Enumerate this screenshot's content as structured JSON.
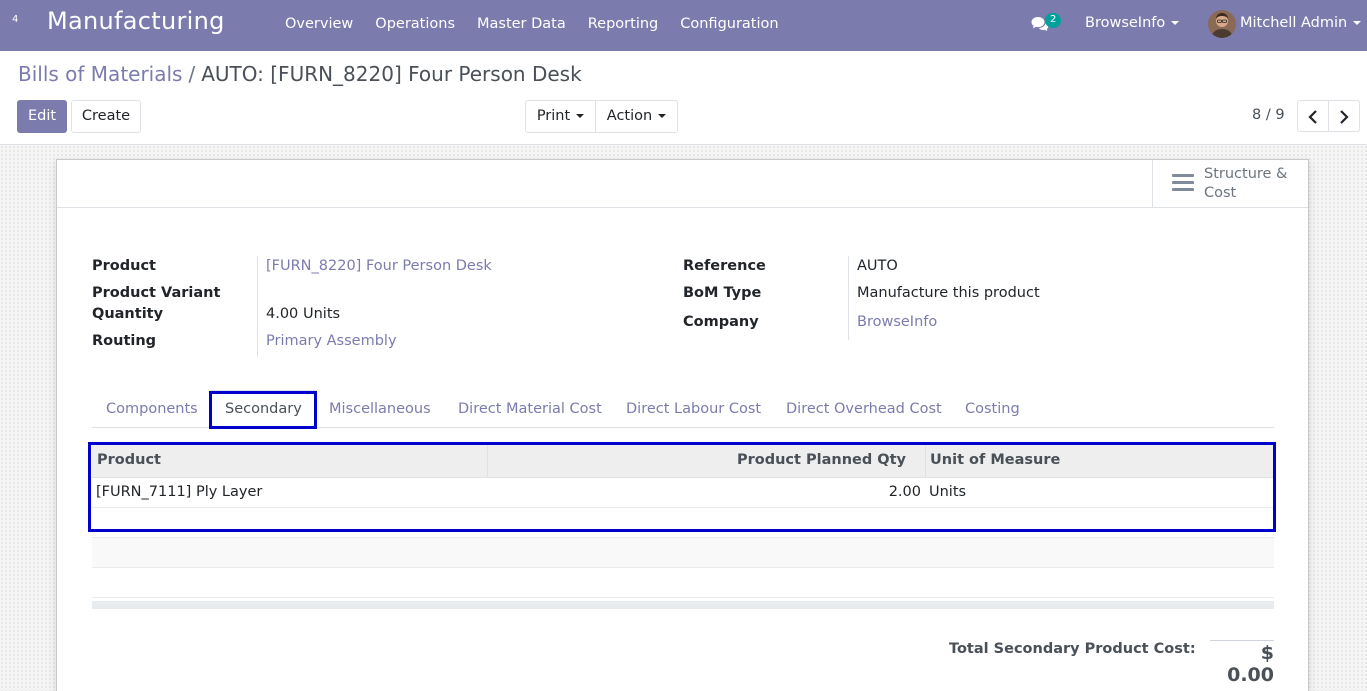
{
  "navbar": {
    "apps_badge": "4",
    "brand": "Manufacturing",
    "menu": [
      "Overview",
      "Operations",
      "Master Data",
      "Reporting",
      "Configuration"
    ],
    "messages_count": "2",
    "company": "BrowseInfo",
    "user": "Mitchell Admin",
    "bg_color": "#7c7bad"
  },
  "breadcrumb": {
    "parent": "Bills of Materials",
    "separator": "/",
    "current": "AUTO: [FURN_8220] Four Person Desk"
  },
  "toolbar": {
    "edit_label": "Edit",
    "create_label": "Create",
    "print_label": "Print",
    "action_label": "Action",
    "pager": "8 / 9"
  },
  "stat_button": {
    "icon": "bars-icon",
    "label": "Structure & Cost"
  },
  "form": {
    "product_label": "Product",
    "product_value": "[FURN_8220] Four Person Desk",
    "variant_label": "Product Variant",
    "quantity_label": "Quantity",
    "quantity_value": "4.00",
    "quantity_uom": "Units",
    "routing_label": "Routing",
    "routing_value": "Primary Assembly",
    "reference_label": "Reference",
    "reference_value": "AUTO",
    "bom_type_label": "BoM Type",
    "bom_type_value": "Manufacture this product",
    "company_label": "Company",
    "company_value": "BrowseInfo"
  },
  "tabs": [
    {
      "label": "Components",
      "active": false
    },
    {
      "label": "Secondary",
      "active": true
    },
    {
      "label": "Miscellaneous",
      "active": false
    },
    {
      "label": "Direct Material Cost",
      "active": false
    },
    {
      "label": "Direct Labour Cost",
      "active": false
    },
    {
      "label": "Direct Overhead Cost",
      "active": false
    },
    {
      "label": "Costing",
      "active": false
    }
  ],
  "secondary_table": {
    "columns": [
      "Product",
      "Product Planned Qty",
      "Unit of Measure"
    ],
    "rows": [
      {
        "product": "[FURN_7111] Ply Layer",
        "qty": "2.00",
        "uom": "Units"
      }
    ]
  },
  "total": {
    "label": "Total Secondary Product Cost:",
    "value": "$ 0.00"
  },
  "colors": {
    "accent": "#7c7bad",
    "highlight": "#0000cc",
    "badge": "#00a09d"
  }
}
